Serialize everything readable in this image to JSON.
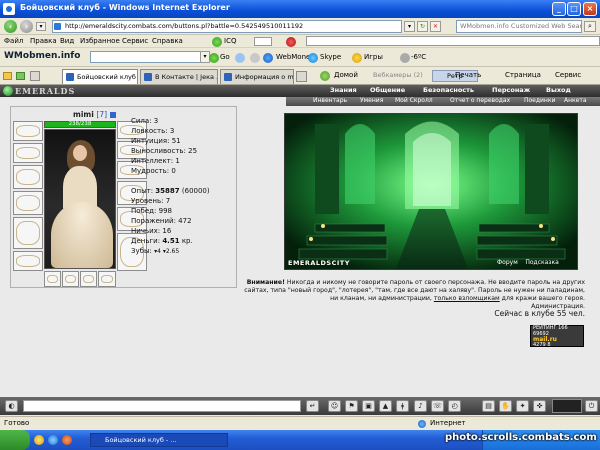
{
  "window": {
    "title": "Бойцовский клуб - Windows Internet Explorer"
  },
  "address_bar": {
    "url": "http://emeraldscity.combats.com/buttons.pl?battle=0.542549510011192",
    "search_placeholder": "WMobmen.info Customized Web Search"
  },
  "menu": {
    "items": [
      "Файл",
      "Правка",
      "Вид",
      "Избранное",
      "Сервис",
      "Справка"
    ],
    "icq": "ICQ",
    "webmoney": "WebMoney",
    "skype": "Skype",
    "games": "Игры",
    "weather": "-6ºC"
  },
  "toolbar2": {
    "brand": "WMobmen.info",
    "go": "Go",
    "home": "Домой",
    "videos": "Вебкамеры (2)",
    "prefix": "Ретр"
  },
  "tabs": [
    {
      "label": "Бойцовский клуб"
    },
    {
      "label": "В Контакте | Jека ..."
    },
    {
      "label": "Информация о mimi"
    }
  ],
  "ie_tools": {
    "print": "Печать",
    "page": "Страница",
    "service": "Сервис"
  },
  "game": {
    "logo": "EMERALDS",
    "top_nav": [
      "Знания",
      "Общение",
      "Безопасность",
      "Персонаж",
      "Выход"
    ],
    "sub_nav": [
      "Инвентарь",
      "Умения",
      "Мой Скролл",
      "Отчет о переводах",
      "Поединки",
      "Анкета"
    ],
    "character": {
      "name": "mimi",
      "level": "[7]",
      "hp": "238/238",
      "stats": [
        {
          "label": "Сила:",
          "value": "3"
        },
        {
          "label": "Ловкость:",
          "value": "3"
        },
        {
          "label": "Интуиция:",
          "value": "51"
        },
        {
          "label": "Выносливость:",
          "value": "25"
        },
        {
          "label": "Интеллект:",
          "value": "1"
        },
        {
          "label": "Мудрость:",
          "value": "0"
        }
      ],
      "exp_label": "Опыт:",
      "exp_value": "35887",
      "exp_next": "(60000)",
      "level_label": "Уровень:",
      "level_value": "7",
      "wins_label": "Побед:",
      "wins_value": "998",
      "losses_label": "Поражений:",
      "losses_value": "472",
      "draws_label": "Ничьих:",
      "draws_value": "16",
      "money_label": "Деньги:",
      "money_value": "4.51",
      "money_unit": "кр.",
      "teeth_label": "Зубы:",
      "teeth_value": "▾4 ▾2.65"
    },
    "scene": {
      "caption": "EMERALDSCITY",
      "link_forum": "Форум",
      "link_hint": "Подсказка"
    },
    "warning": {
      "bold": "Внимание!",
      "text": " Никогда и никому не говорите пароль от своего персонажа. Не вводите пароль на других сайтах, типа \"новый город\", \"лотерея\", \"там, где все дают на халяву\". Пароль не нужен ни паладинам, ни кланам, ни администрации,",
      "underline": "только взломщикам",
      "tail": " для кражи вашего героя.",
      "signature": "Администрация."
    },
    "online": "Сейчас в клубе 55 чел.",
    "counter": {
      "line1": "РЕЙТИНГ 166 69692",
      "line2": "mail.ru",
      "line3": "4279 8"
    }
  },
  "status_bar": {
    "left": "Готово",
    "zone": "Интернет"
  },
  "taskbar": {
    "item": "Бойцовский клуб - ..."
  },
  "watermark": "photo.scrolls.combats.com"
}
